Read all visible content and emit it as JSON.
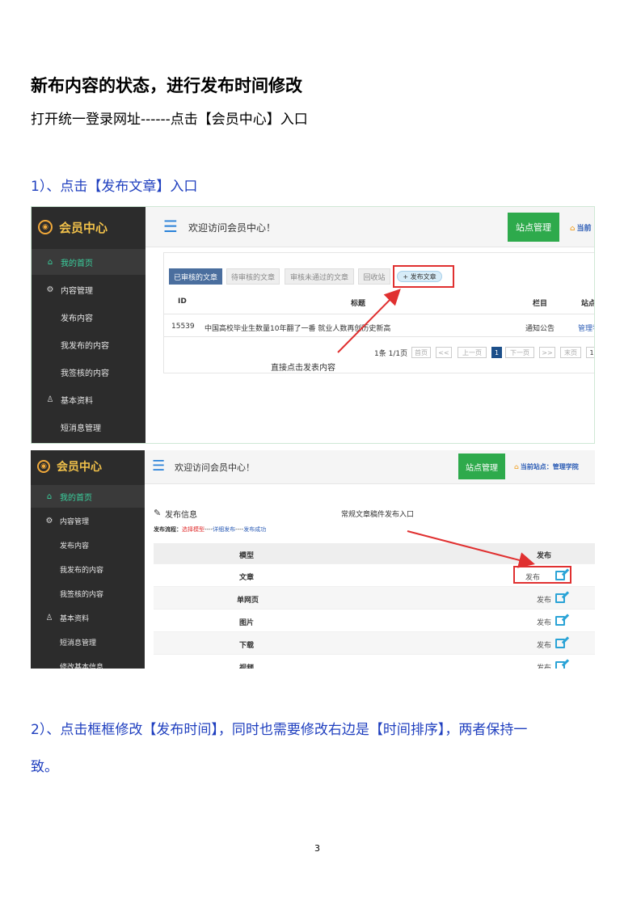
{
  "doc": {
    "heading": "新布内容的状态，进行发布时间修改",
    "intro": "打开统一登录网址------点击【会员中心】入口",
    "step1": "1）、点击【发布文章】入口",
    "step2_line1": "2）、点击框框修改【发布时间】，同时也需要修改右边是【时间排序】，两者保持一",
    "step2_line2": "致。",
    "page_number": "3"
  },
  "shot1": {
    "logo": "会员中心",
    "logo_icon": "wifi-badge-icon",
    "welcome": "欢迎访问会员中心！",
    "site_btn": "站点管理",
    "current_site": "当前",
    "nav": [
      {
        "label": "我的首页",
        "icon": "home-icon"
      },
      {
        "label": "内容管理",
        "icon": "gear-icon"
      },
      {
        "label": "发布内容",
        "icon": ""
      },
      {
        "label": "我发布的内容",
        "icon": ""
      },
      {
        "label": "我签核的内容",
        "icon": ""
      },
      {
        "label": "基本资料",
        "icon": "user-icon"
      },
      {
        "label": "短消息管理",
        "icon": ""
      }
    ],
    "tabs": [
      "已审核的文章",
      "待审核的文章",
      "审核未通过的文章",
      "回收站"
    ],
    "publish_btn": "+ 发布文章",
    "columns": {
      "id": "ID",
      "title": "标题",
      "column": "栏目",
      "site": "站点"
    },
    "row": {
      "id": "15539",
      "title": "中国高校毕业生数量10年翻了一番 就业人数再创历史新高",
      "column": "通知公告",
      "site": "管理学"
    },
    "pagination": {
      "summary": "1条 1/1页",
      "first": "首页",
      "prev2": "<<",
      "prev": "上一页",
      "current": "1",
      "next": "下一页",
      "next2": ">>",
      "last": "末页",
      "box": "1"
    },
    "annotation": "直接点击发表内容"
  },
  "shot2": {
    "logo": "会员中心",
    "logo_icon": "wifi-badge-icon",
    "welcome": "欢迎访问会员中心！",
    "site_btn": "站点管理",
    "current_label": "当前站点：",
    "current_site": "管理学院",
    "nav": [
      {
        "label": "我的首页",
        "icon": "home-icon"
      },
      {
        "label": "内容管理",
        "icon": "gear-icon"
      },
      {
        "label": "发布内容",
        "icon": ""
      },
      {
        "label": "我发布的内容",
        "icon": ""
      },
      {
        "label": "我签核的内容",
        "icon": ""
      },
      {
        "label": "基本资料",
        "icon": "user-icon"
      },
      {
        "label": "短消息管理",
        "icon": ""
      },
      {
        "label": "修改基本信息",
        "icon": ""
      }
    ],
    "section_title": "发布信息",
    "flow_label": "发布流程：",
    "flow_step1": "选择模型",
    "flow_sep": "----",
    "flow_step2": "详细发布",
    "flow_step3": "发布成功",
    "annotation": "常规文章稿件发布入口",
    "col_model": "模型",
    "col_publish": "发布",
    "models": [
      {
        "name": "文章",
        "action": "发布"
      },
      {
        "name": "单网页",
        "action": "发布"
      },
      {
        "name": "图片",
        "action": "发布"
      },
      {
        "name": "下载",
        "action": "发布"
      },
      {
        "name": "视频",
        "action": "发布"
      }
    ]
  }
}
